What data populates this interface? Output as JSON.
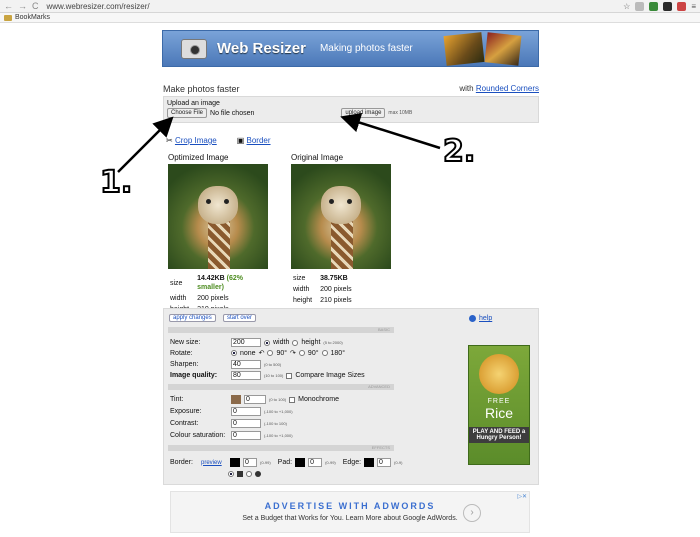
{
  "browser": {
    "url": "www.webresizer.com/resizer/",
    "bookmarks_label": "BookMarks"
  },
  "banner": {
    "title": "Web Resizer",
    "tagline": "Making photos faster"
  },
  "header": {
    "heading": "Make photos faster",
    "with_text": "with",
    "rounded_link": "Rounded Corners"
  },
  "upload": {
    "label": "Upload an image",
    "choose_file": "Choose File",
    "no_file": "No file chosen",
    "upload_button": "upload image",
    "max_note": "max 10MB"
  },
  "links": {
    "crop": "Crop Image",
    "border": "Border"
  },
  "optimized": {
    "title": "Optimized Image",
    "size_label": "size",
    "size_value": "14.42KB",
    "savings": "(62% smaller)",
    "width_label": "width",
    "width_value": "200 pixels",
    "height_label": "height",
    "height_value": "210 pixels"
  },
  "original": {
    "title": "Original Image",
    "size_label": "size",
    "size_value": "38.75KB",
    "width_label": "width",
    "width_value": "200 pixels",
    "height_label": "height",
    "height_value": "210 pixels"
  },
  "settings": {
    "apply": "apply changes",
    "start_over": "start over",
    "help": "help",
    "sec_basic": "BASIC",
    "sec_advanced": "ADVANCED",
    "sec_effects": "EFFECTS",
    "new_size_label": "New size:",
    "new_size_value": "200",
    "width_opt": "width",
    "height_opt": "height",
    "height_range": "(5 to 2000)",
    "rotate_label": "Rotate:",
    "rotate_none": "none",
    "rotate_90a": "90°",
    "rotate_90b": "90°",
    "rotate_180": "180°",
    "sharpen_label": "Sharpen:",
    "sharpen_value": "40",
    "sharpen_range": "(0 to 500)",
    "quality_label": "Image quality:",
    "quality_value": "80",
    "quality_range": "(10 to 100)",
    "compare_label": "Compare Image Sizes",
    "tint_label": "Tint:",
    "tint_value": "0",
    "tint_range": "(0 to 100)",
    "mono_label": "Monochrome",
    "exposure_label": "Exposure:",
    "exposure_value": "0",
    "exposure_range": "(-100 to +1,000)",
    "contrast_label": "Contrast:",
    "contrast_value": "0",
    "contrast_range": "(-100 to 100)",
    "saturation_label": "Colour saturation:",
    "saturation_value": "0",
    "saturation_range": "(-100 to +1,000)",
    "border_label": "Border:",
    "preview": "preview",
    "border_value": "0",
    "border_range": "(0-99)",
    "pad_label": "Pad:",
    "pad_value": "0",
    "pad_range": "(0-99)",
    "edge_label": "Edge:",
    "edge_value": "0",
    "edge_range": "(0-9)"
  },
  "rice_ad": {
    "free": "FREE",
    "rice": "Rice",
    "play": "PLAY AND FEED a Hungry Person!"
  },
  "adwords": {
    "headline": "ADVERTISE WITH ADWORDS",
    "sub": "Set a Budget that Works for You. Learn More about Google AdWords."
  },
  "annotations": {
    "one": "1.",
    "two": "2."
  },
  "colors": {
    "link": "#1a4fbf",
    "accent_green": "#4c8c1f",
    "tint_swatch": "#8b6a4a"
  }
}
